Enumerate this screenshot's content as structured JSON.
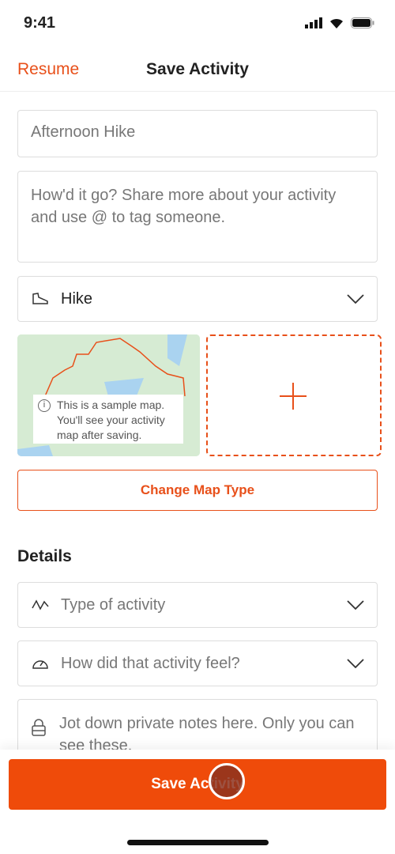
{
  "status": {
    "time": "9:41"
  },
  "nav": {
    "back": "Resume",
    "title": "Save Activity"
  },
  "form": {
    "title_placeholder": "Afternoon Hike",
    "description_placeholder": "How'd it go? Share more about your activity and use @ to tag someone.",
    "sport": "Hike",
    "map_note": "This is a sample map. You'll see your activity map after saving.",
    "change_map": "Change Map Type"
  },
  "details": {
    "heading": "Details",
    "activity_type_placeholder": "Type of activity",
    "feel_placeholder": "How did that activity feel?",
    "private_notes_placeholder": "Jot down private notes here. Only you can see these."
  },
  "footer": {
    "save": "Save Activity"
  },
  "colors": {
    "accent": "#ef4b0a"
  }
}
